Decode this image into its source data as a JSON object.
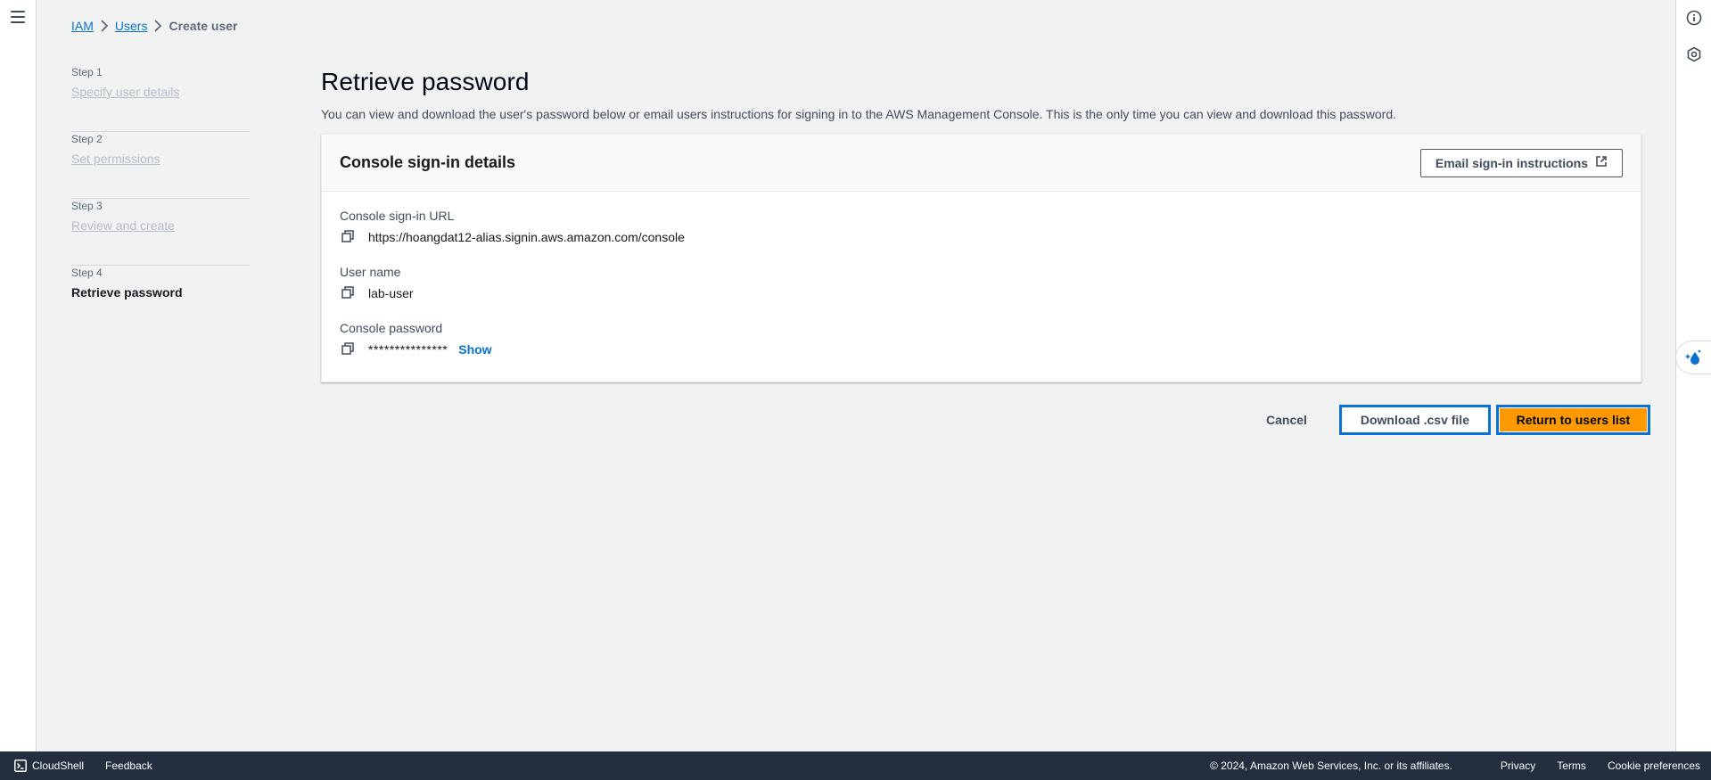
{
  "breadcrumb": {
    "items": [
      "IAM",
      "Users"
    ],
    "current": "Create user"
  },
  "steps": [
    {
      "num": "Step 1",
      "label": "Specify user details"
    },
    {
      "num": "Step 2",
      "label": "Set permissions"
    },
    {
      "num": "Step 3",
      "label": "Review and create"
    },
    {
      "num": "Step 4",
      "label": "Retrieve password"
    }
  ],
  "main": {
    "title": "Retrieve password",
    "description": "You can view and download the user's password below or email users instructions for signing in to the AWS Management Console. This is the only time you can view and download this password."
  },
  "card": {
    "title": "Console sign-in details",
    "email_button": "Email sign-in instructions",
    "fields": {
      "url_label": "Console sign-in URL",
      "url_value": "https://hoangdat12-alias.signin.aws.amazon.com/console",
      "username_label": "User name",
      "username_value": "lab-user",
      "password_label": "Console password",
      "password_value": "***************",
      "show_label": "Show"
    }
  },
  "actions": {
    "cancel": "Cancel",
    "download": "Download .csv file",
    "return": "Return to users list"
  },
  "footer": {
    "cloudshell": "CloudShell",
    "feedback": "Feedback",
    "copyright": "© 2024, Amazon Web Services, Inc. or its affiliates.",
    "privacy": "Privacy",
    "terms": "Terms",
    "cookie": "Cookie preferences"
  },
  "icons": {
    "menu": "hamburger-menu-icon",
    "info": "info-icon",
    "settings": "hexagon-settings-icon",
    "copy": "copy-icon",
    "external": "external-link-icon",
    "cloudshell": "cloudshell-icon",
    "widget": "droplet-sparkle-icon"
  },
  "colors": {
    "link": "#0972d3",
    "primary_button": "#ff9900",
    "focus_ring": "#0972d3",
    "footer_bg": "#232f3e"
  }
}
